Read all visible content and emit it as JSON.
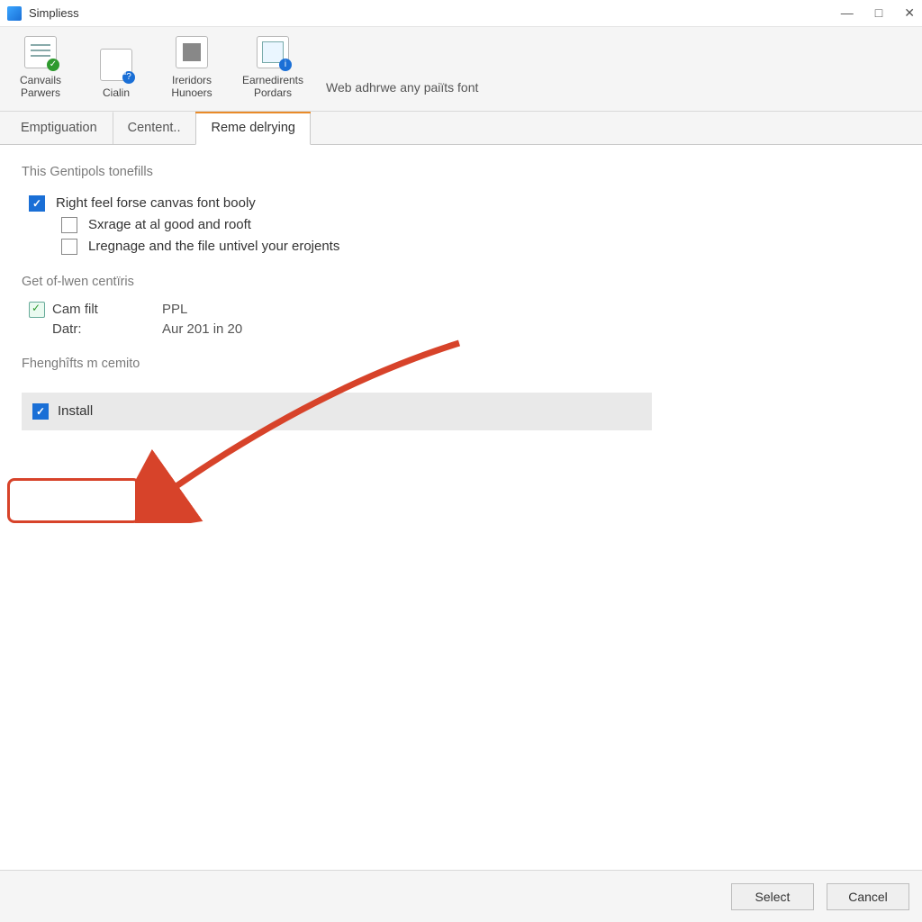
{
  "window": {
    "title": "Simpliess"
  },
  "toolbar": {
    "items": [
      {
        "line1": "Canvails",
        "line2": "Parwers"
      },
      {
        "line1": "Cialin",
        "line2": ""
      },
      {
        "line1": "Ireridors",
        "line2": "Hunoers"
      },
      {
        "line1": "Earnedirents",
        "line2": "Pordars"
      }
    ],
    "right_text": "Web adhrwe any paiïts font"
  },
  "tabs": [
    {
      "label": "Emptiguation",
      "active": false
    },
    {
      "label": "Centent..",
      "active": false
    },
    {
      "label": "Reme delrying",
      "active": true
    }
  ],
  "panel": {
    "section1": "This Gentipols tonefills",
    "chk_main": "Right feel forse canvas font booly",
    "chk_sub1": "Sxrage at al good and rooft",
    "chk_sub2": "Lregnage and the file untivel your erojents",
    "section2": "Get of-lwen centïris",
    "kv1_k": "Cam filt",
    "kv1_v": "PPL",
    "kv2_k": "Datr:",
    "kv2_v": "Aur 201 in 20",
    "section3": "Fhenghîfts m cemito",
    "install_label": "Install"
  },
  "footer": {
    "select": "Select",
    "cancel": "Cancel"
  }
}
